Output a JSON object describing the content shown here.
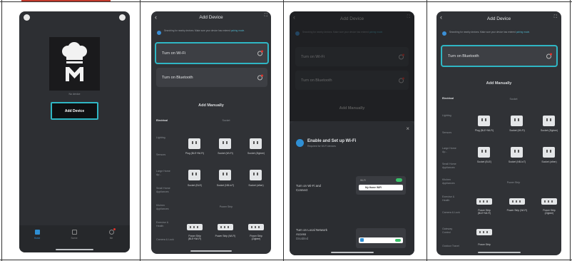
{
  "grid": {
    "lines": 4
  },
  "screens": [
    {
      "id": "home",
      "account_label": "No device",
      "add_button": "Add Device",
      "tabs": [
        {
          "label": "Home",
          "icon": "home-icon"
        },
        {
          "label": "Scene",
          "icon": "scene-icon"
        },
        {
          "label": "Me",
          "icon": "user-icon"
        }
      ],
      "colors": {
        "accent": "#2fb6c4"
      }
    },
    {
      "id": "add-device-wifi",
      "title": "Add Device",
      "notice": "Searching for nearby devices. Make sure your device has entered",
      "notice_link": "pairing mode.",
      "options": [
        "Turn on Wi-Fi",
        "Turn on Bluetooth"
      ],
      "section": "Add Manually",
      "categories": [
        "Electrical",
        "Lighting",
        "Sensors",
        "Large Home Ap...",
        "Small Home Appliances",
        "Kitchen Appliances",
        "Exercise & Health",
        "Camera & Lock"
      ],
      "groups": [
        "Socket",
        "Power Strip"
      ],
      "devices_row1": [
        "Plug (BLE+Wi-Fi)",
        "Socket (Wi-Fi)",
        "Socket (Zigbee)"
      ],
      "devices_row2": [
        "Socket (BLE)",
        "Socket (NB-IoT)",
        "Socket (other)"
      ],
      "devices_row3": [
        "Power Strip (BLE+Wi-Fi)",
        "Power Strip (Wi-Fi)",
        "Power Strip (Zigbee)"
      ]
    },
    {
      "id": "enable-wifi",
      "title": "Add Device",
      "options": [
        "Turn on Wi-Fi",
        "Turn on Bluetooth"
      ],
      "section": "Add Manually",
      "modal_title": "Enable and Set up Wi-Fi",
      "modal_sub": "Required for Wi-Fi devices",
      "row1": "Turn on Wi-Fi and Connect",
      "wifi_label": "Wi-Fi",
      "network": "My Home WiFi",
      "row2": "Turn on Local Network Access",
      "row2_status": "Disabled",
      "close": "×"
    },
    {
      "id": "add-device-bluetooth",
      "title": "Add Device",
      "option": "Turn on Bluetooth",
      "section": "Add Manually",
      "categories": [
        "Electrical",
        "Lighting",
        "Sensors",
        "Large Home Ap...",
        "Small Home Appliances",
        "Kitchen Appliances",
        "Exercise & Health",
        "Camera & Lock",
        "Gateway Control",
        "Outdoor Travel"
      ],
      "groups": [
        "Socket",
        "Power Strip"
      ],
      "devices_row1": [
        "Plug (BLE+Wi-Fi)",
        "Socket (Wi-Fi)",
        "Socket (Zigbee)"
      ],
      "devices_row2": [
        "Socket (BLE)",
        "Socket (NB-IoT)",
        "Socket (other)"
      ],
      "devices_row3": [
        "Power Strip (BLE+Wi-Fi)",
        "Power Strip (Wi-Fi)",
        "Power Strip (Zigbee)"
      ],
      "devices_row4": [
        "Power Strip"
      ]
    }
  ]
}
